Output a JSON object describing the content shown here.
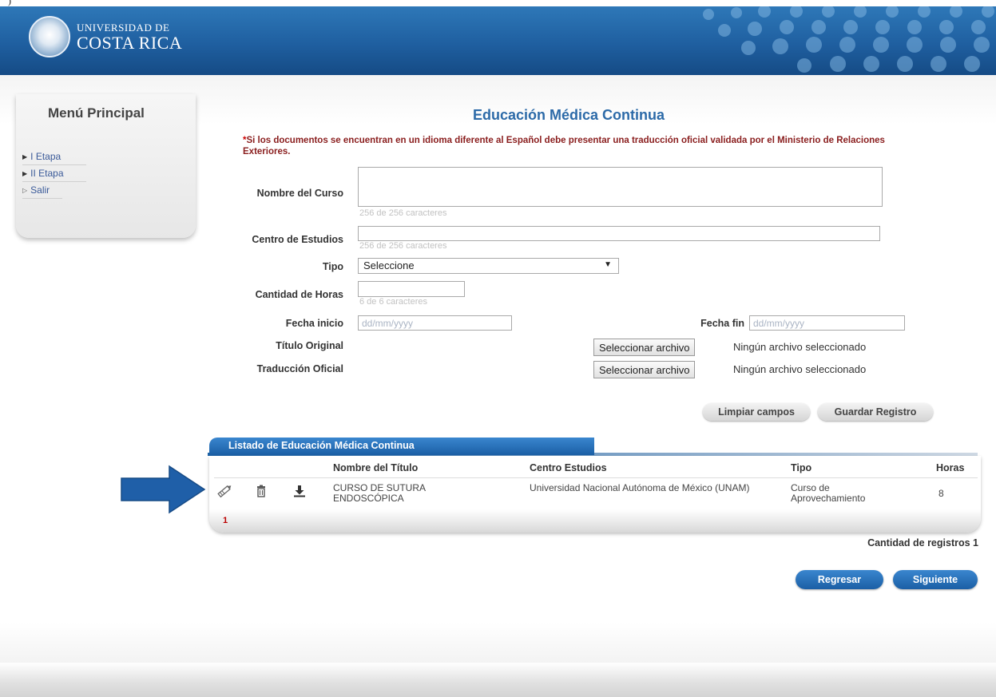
{
  "caption_fragment": ")",
  "brand": {
    "line1": "UNIVERSIDAD DE",
    "line2": "COSTA RICA"
  },
  "sidebar": {
    "title": "Menú Principal",
    "items": [
      {
        "label": "I Etapa"
      },
      {
        "label": "II Etapa"
      },
      {
        "label": "Salir"
      }
    ]
  },
  "form": {
    "title": "Educación Médica Continua",
    "notice": "Si los documentos se encuentran en un idioma diferente al Español debe presentar una traducción oficial validada por el Ministerio de Relaciones Exteriores.",
    "notice_star": "*",
    "nombre_label": "Nombre del Curso",
    "nombre_value": "",
    "nombre_hint": "256 de 256 caracteres",
    "centro_label": "Centro de Estudios",
    "centro_value": "",
    "centro_hint": "256 de 256 caracteres",
    "tipo_label": "Tipo",
    "tipo_selected": "Seleccione",
    "horas_label": "Cantidad de Horas",
    "horas_value": "",
    "horas_hint": "6 de 6 caracteres",
    "fecha_inicio_label": "Fecha inicio",
    "fecha_inicio_placeholder": "dd/mm/yyyy",
    "fecha_fin_label": "Fecha fin",
    "fecha_fin_placeholder": "dd/mm/yyyy",
    "titulo_label": "Título Original",
    "traduccion_label": "Traducción Oficial",
    "file_button": "Seleccionar archivo",
    "file_status": "Ningún archivo seleccionado",
    "limpiar": "Limpiar campos",
    "guardar": "Guardar Registro"
  },
  "listing": {
    "tab_title": "Listado de Educación Médica Continua",
    "columns": [
      "Nombre del Título",
      "Centro Estudios",
      "Tipo",
      "Horas"
    ],
    "rows": [
      {
        "titulo": "CURSO DE SUTURA ENDOSCÓPICA",
        "centro": "Universidad Nacional Autónoma de México (UNAM)",
        "tipo": "Curso de Aprovechamiento",
        "horas": "8"
      }
    ],
    "page": "1",
    "count_label": "Cantidad de registros 1"
  },
  "nav": {
    "regresar": "Regresar",
    "siguiente": "Siguiente"
  },
  "colors": {
    "header_blue": "#1f5fa0",
    "title_blue": "#2c6aa8",
    "notice_red": "#8a1e1e",
    "arrow_blue": "#1f5fa8"
  }
}
